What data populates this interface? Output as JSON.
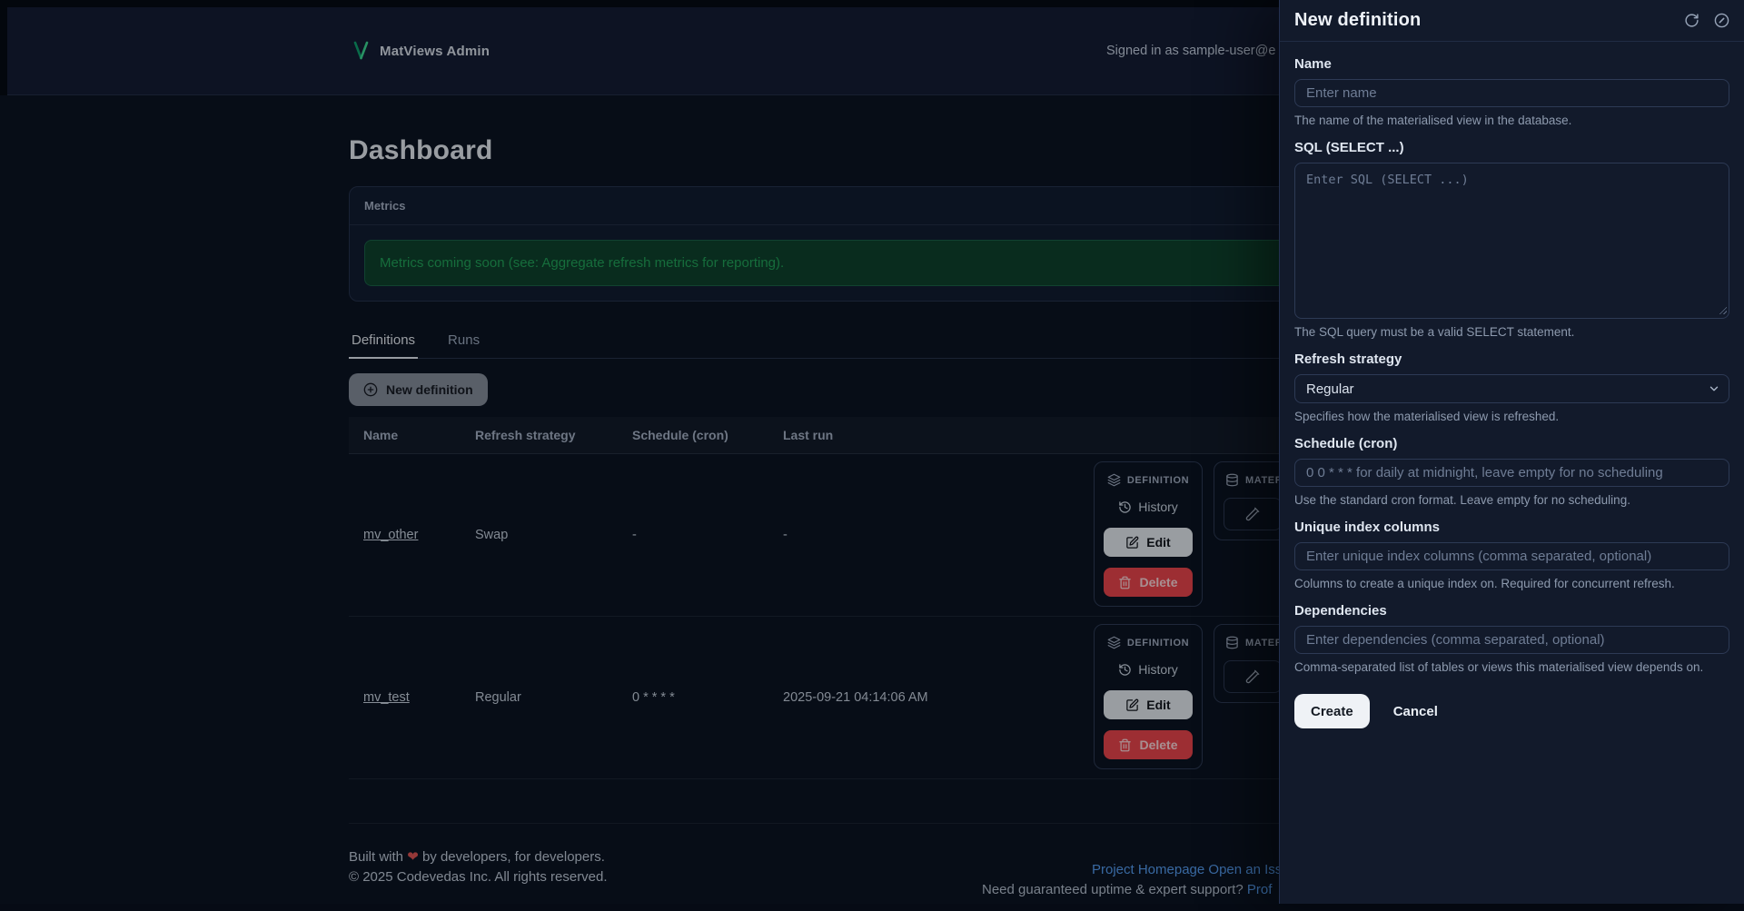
{
  "header": {
    "app_title": "MatViews Admin",
    "signed_in": "Signed in as sample-user@e"
  },
  "page": {
    "title": "Dashboard"
  },
  "metrics": {
    "title": "Metrics",
    "message": "Metrics coming soon (see: Aggregate refresh metrics for reporting)."
  },
  "tabs": [
    {
      "label": "Definitions"
    },
    {
      "label": "Runs"
    }
  ],
  "toolbar": {
    "new_definition": "New definition"
  },
  "table": {
    "columns": [
      "Name",
      "Refresh strategy",
      "Schedule (cron)",
      "Last run"
    ],
    "rows": [
      {
        "name": "mv_other",
        "strategy": "Swap",
        "schedule": "-",
        "last_run": "-"
      },
      {
        "name": "mv_test",
        "strategy": "Regular",
        "schedule": "0 * * * *",
        "last_run": "2025-09-21 04:14:06 AM"
      }
    ],
    "action_groups": {
      "definition": "DEFINITION",
      "materialized": "MATER",
      "history": "History",
      "edit": "Edit",
      "delete": "Delete"
    }
  },
  "footer": {
    "built_prefix": "Built with",
    "heart": "❤",
    "built_suffix": "by developers, for developers.",
    "copyright": "© 2025 Codevedas Inc. All rights reserved.",
    "link_homepage": "Project Homepage",
    "link_issue": "Open an Iss",
    "support_text": "Need guaranteed uptime & expert support?",
    "support_link": "Prof"
  },
  "drawer": {
    "title": "New definition",
    "name": {
      "label": "Name",
      "placeholder": "Enter name",
      "help": "The name of the materialised view in the database."
    },
    "sql": {
      "label": "SQL (SELECT ...)",
      "placeholder": "Enter SQL (SELECT ...)",
      "help": "The SQL query must be a valid SELECT statement."
    },
    "refresh_strategy": {
      "label": "Refresh strategy",
      "value": "Regular",
      "help": "Specifies how the materialised view is refreshed."
    },
    "schedule": {
      "label": "Schedule (cron)",
      "placeholder": "0 0 * * * for daily at midnight, leave empty for no scheduling",
      "help": "Use the standard cron format. Leave empty for no scheduling."
    },
    "unique_index": {
      "label": "Unique index columns",
      "placeholder": "Enter unique index columns (comma separated, optional)",
      "help": "Columns to create a unique index on. Required for concurrent refresh."
    },
    "dependencies": {
      "label": "Dependencies",
      "placeholder": "Enter dependencies (comma separated, optional)",
      "help": "Comma-separated list of tables or views this materialised view depends on."
    },
    "create_label": "Create",
    "cancel_label": "Cancel"
  },
  "colors": {
    "accent_green": "#34d399",
    "success_text": "#22a65b",
    "danger": "#ef464e",
    "link_blue": "#57a0f6",
    "drawer_bg": "#121a2b",
    "page_bg": "#0b1423"
  }
}
